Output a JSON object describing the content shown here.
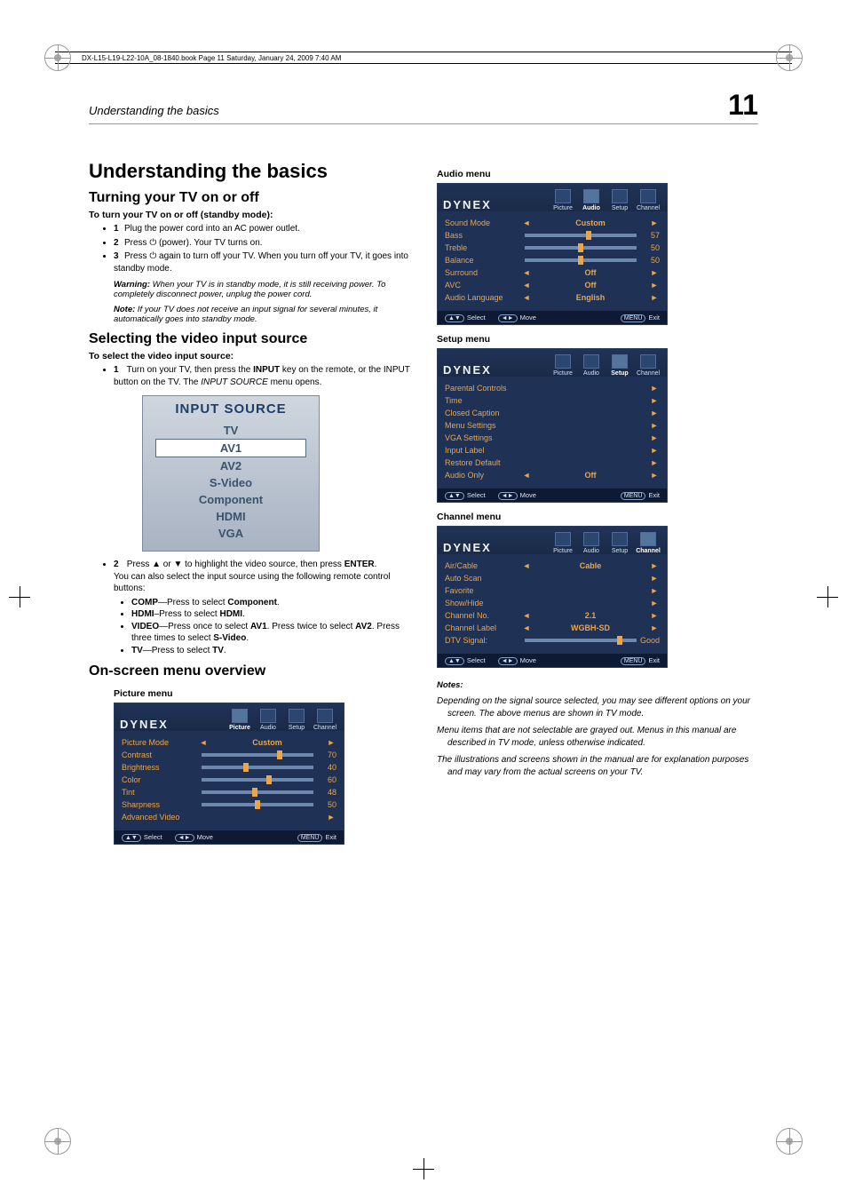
{
  "bookline": "DX-L15-L19-L22-10A_08-1840.book  Page 11  Saturday, January 24, 2009  7:40 AM",
  "runhead": "Understanding the basics",
  "pagenum": "11",
  "h1": "Understanding the basics",
  "sec1": {
    "h2": "Turning your TV on or off",
    "h3": "To turn your TV on or off (standby mode):",
    "s1": "Plug the power cord into an AC power outlet.",
    "s2a": "Press ",
    "s2b": " (power). Your TV turns on.",
    "s3a": "Press ",
    "s3b": " again to turn off your TV. When you turn off your TV, it goes into standby mode.",
    "warnLead": "Warning:",
    "warn": " When your TV is in standby mode, it is still receiving power. To completely disconnect power, unplug the power cord.",
    "noteLead": "Note:",
    "note": " If your TV does not receive an input signal for several minutes, it automatically goes into standby mode."
  },
  "sec2": {
    "h2": "Selecting the video input source",
    "h3": "To select the video input source:",
    "s1a": "Turn on your TV, then press the ",
    "s1b": "INPUT",
    "s1c": " key on the remote, or the INPUT button on the TV. The ",
    "s1d": "INPUT SOURCE",
    "s1e": " menu opens.",
    "src": {
      "title": "INPUT SOURCE",
      "opts": [
        "TV",
        "AV1",
        "AV2",
        "S-Video",
        "Component",
        "HDMI",
        "VGA"
      ],
      "selected": 1
    },
    "s2a": "Press ▲ or ▼ to highlight the video source, then press ",
    "s2b": "ENTER",
    "s2c": ".",
    "s2d": "You can also select the input source using the following remote control buttons:",
    "b1a": "COMP",
    "b1b": "—Press to select ",
    "b1c": "Component",
    "b1d": ".",
    "b2a": "HDMI",
    "b2b": "–Press to select ",
    "b2c": "HDMI",
    "b2d": ".",
    "b3a": "VIDEO",
    "b3b": "—Press once to select ",
    "b3c": "AV1",
    "b3d": ". Press twice to select ",
    "b3e": "AV2",
    "b3f": ". Press three times to select ",
    "b3g": "S-Video",
    "b3h": ".",
    "b4a": "TV",
    "b4b": "—Press to select ",
    "b4c": "TV",
    "b4d": "."
  },
  "sec3": {
    "h2": "On-screen menu overview"
  },
  "pic": {
    "hdr": "Picture menu",
    "logo": "DYNEX",
    "tabs": [
      "Picture",
      "Audio",
      "Setup",
      "Channel"
    ],
    "rows": [
      {
        "lab": "Picture Mode",
        "val": "Custom"
      },
      {
        "lab": "Contrast",
        "num": "70",
        "pos": 70
      },
      {
        "lab": "Brightness",
        "num": "40",
        "pos": 40
      },
      {
        "lab": "Color",
        "num": "60",
        "pos": 60
      },
      {
        "lab": "Tint",
        "num": "48",
        "pos": 48
      },
      {
        "lab": "Sharpness",
        "num": "50",
        "pos": 50
      },
      {
        "lab": "Advanced Video",
        "arrowOnly": true
      }
    ],
    "foot": {
      "sel": "Select",
      "mov": "Move",
      "menu": "MENU",
      "exit": "Exit"
    }
  },
  "aud": {
    "hdr": "Audio menu",
    "rows": [
      {
        "lab": "Sound Mode",
        "val": "Custom"
      },
      {
        "lab": "Bass",
        "num": "57",
        "pos": 57
      },
      {
        "lab": "Treble",
        "num": "50",
        "pos": 50
      },
      {
        "lab": "Balance",
        "num": "50",
        "pos": 50
      },
      {
        "lab": "Surround",
        "val": "Off"
      },
      {
        "lab": "AVC",
        "val": "Off"
      },
      {
        "lab": "Audio Language",
        "val": "English"
      }
    ]
  },
  "setup": {
    "hdr": "Setup menu",
    "rows": [
      {
        "lab": "Parental Controls",
        "arrowOnly": true
      },
      {
        "lab": "Time",
        "arrowOnly": true
      },
      {
        "lab": "Closed Caption",
        "arrowOnly": true
      },
      {
        "lab": "Menu Settings",
        "arrowOnly": true
      },
      {
        "lab": "VGA Settings",
        "arrowOnly": true
      },
      {
        "lab": "Input Label",
        "arrowOnly": true
      },
      {
        "lab": "Restore Default",
        "arrowOnly": true
      },
      {
        "lab": "Audio Only",
        "val": "Off"
      }
    ]
  },
  "chan": {
    "hdr": "Channel menu",
    "rows": [
      {
        "lab": "Air/Cable",
        "val": "Cable"
      },
      {
        "lab": "Auto Scan",
        "arrowOnly": true
      },
      {
        "lab": "Favorite",
        "arrowOnly": true
      },
      {
        "lab": "Show/Hide",
        "arrowOnly": true
      },
      {
        "lab": "Channel No.",
        "val": "2.1"
      },
      {
        "lab": "Channel Label",
        "val": "WGBH-SD"
      }
    ],
    "dtvLab": "DTV Signal:",
    "dtvVal": "Good"
  },
  "notesHdr": "Notes:",
  "n1": "Depending on the signal source selected, you may see different options on your screen. The above menus are shown in TV mode.",
  "n2": "Menu items that are not selectable are grayed out. Menus in this manual are described in TV mode, unless otherwise indicated.",
  "n3": "The illustrations and screens shown in the manual are for explanation purposes and may vary from the actual screens on your TV.",
  "tabset": [
    "Picture",
    "Audio",
    "Setup",
    "Channel"
  ]
}
